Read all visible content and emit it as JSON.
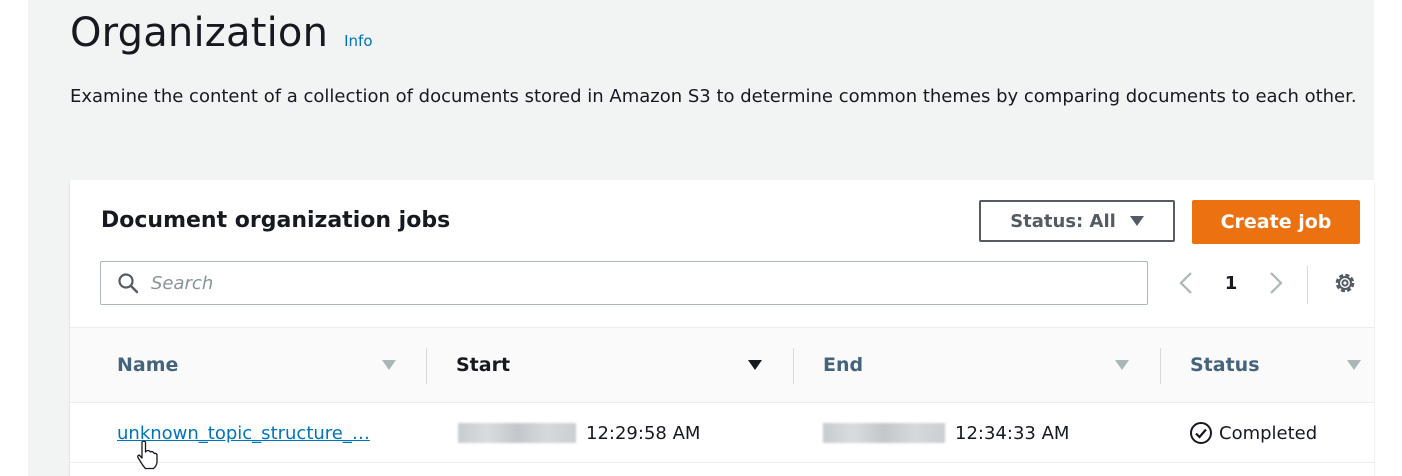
{
  "header": {
    "title": "Organization",
    "info_label": "Info",
    "description": "Examine the content of a collection of documents stored in Amazon S3 to determine common themes by comparing documents to each other."
  },
  "panel": {
    "title": "Document organization jobs",
    "status_filter_label": "Status: All",
    "create_button_label": "Create job",
    "search_placeholder": "Search",
    "search_value": "",
    "pagination": {
      "current_page": "1"
    }
  },
  "table": {
    "columns": [
      {
        "label": "Name"
      },
      {
        "label": "Start"
      },
      {
        "label": "End"
      },
      {
        "label": "Status"
      }
    ],
    "rows": [
      {
        "name": "unknown_topic_structure_…",
        "start_time": "12:29:58 AM",
        "end_time": "12:34:33 AM",
        "status": "Completed"
      }
    ]
  },
  "colors": {
    "link": "#0073bb",
    "primary_button": "#ec7211",
    "page_background": "#f2f3f3",
    "success": "#1d8102"
  },
  "icons": {
    "search": "search-icon",
    "prev": "chevron-left-icon",
    "next": "chevron-right-icon",
    "settings": "gear-icon",
    "status": "check-circle-icon",
    "filter_caret": "caret-down-icon"
  }
}
